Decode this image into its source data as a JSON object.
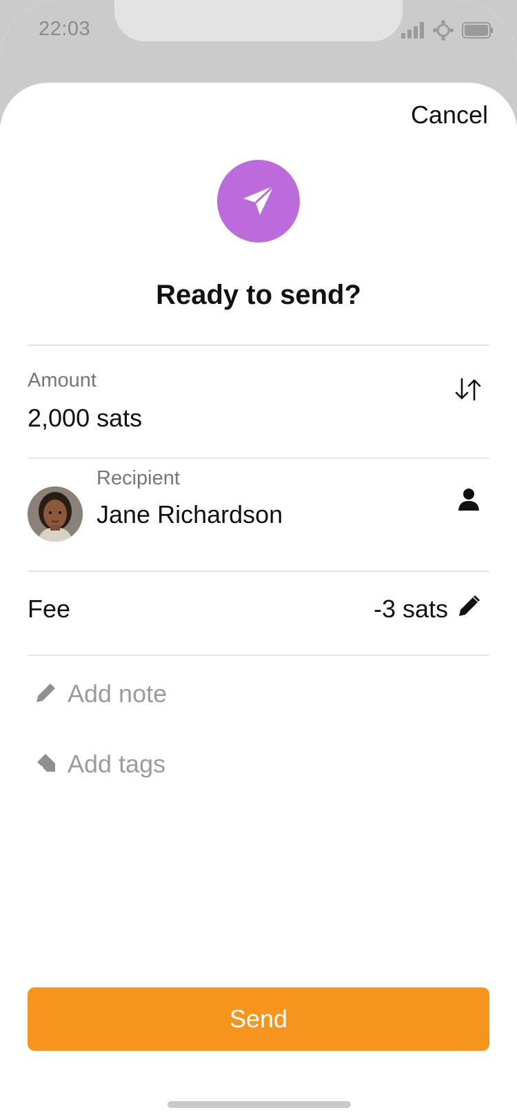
{
  "status_bar": {
    "time": "22:03",
    "icons": [
      "signal-icon",
      "location-icon",
      "battery-icon"
    ]
  },
  "header": {
    "cancel_label": "Cancel"
  },
  "hero": {
    "icon": "send-arrow-icon",
    "icon_color": "#bb6bda",
    "title": "Ready to send?"
  },
  "amount": {
    "label": "Amount",
    "value": "2,000 sats",
    "action_icon": "swap-arrows-icon"
  },
  "recipient": {
    "label": "Recipient",
    "name": "Jane Richardson",
    "action_icon": "contact-icon"
  },
  "fee": {
    "label": "Fee",
    "value": "-3 sats",
    "action_icon": "edit-pencil-icon"
  },
  "note": {
    "placeholder": "Add note",
    "icon": "pencil-icon"
  },
  "tags": {
    "placeholder": "Add tags",
    "icon": "tag-icon"
  },
  "send_button": {
    "label": "Send",
    "color": "#f6941e"
  }
}
